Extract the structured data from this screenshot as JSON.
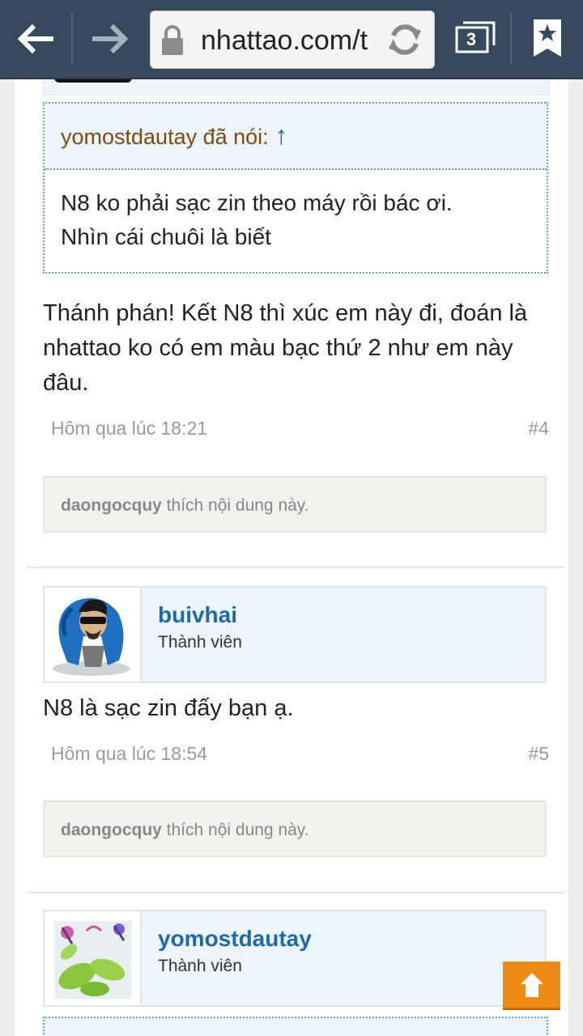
{
  "browser": {
    "url_text": "nhattao.com/t",
    "tab_count": "3",
    "icons": [
      "back-icon",
      "forward-icon",
      "lock-icon",
      "reload-icon",
      "tabs-icon",
      "bookmark-icon"
    ]
  },
  "post4": {
    "quote_author": "yomostdautay đã nói:",
    "quote_arrow": "↑",
    "quote_line1": "N8 ko phải sạc zin theo máy rồi bác ơi.",
    "quote_line2": "Nhìn cái chuôi là biết",
    "text_line1": "Thánh phán! Kết N8 thì xúc em này đi, đoán là",
    "text_line2": "nhattao ko có em màu bạc thứ 2 như em này",
    "text_line3": "đâu.",
    "time": "Hôm qua lúc 18:21",
    "number": "#4",
    "liker": "daongocquy",
    "likes_suffix": " thích nội dung này."
  },
  "post5": {
    "username": "buivhai",
    "role": "Thành viên",
    "text": "N8 là sạc zin đấy bạn ạ.",
    "time": "Hôm qua lúc 18:54",
    "number": "#5",
    "liker": "daongocquy",
    "likes_suffix": " thích nội dung này."
  },
  "post6": {
    "username": "yomostdautay",
    "role": "Thành viên"
  },
  "colors": {
    "toolbar": "#36495c",
    "username": "#1e69a7",
    "quote_author": "#7b4a12",
    "scroll_top_button": "#f08a14"
  }
}
